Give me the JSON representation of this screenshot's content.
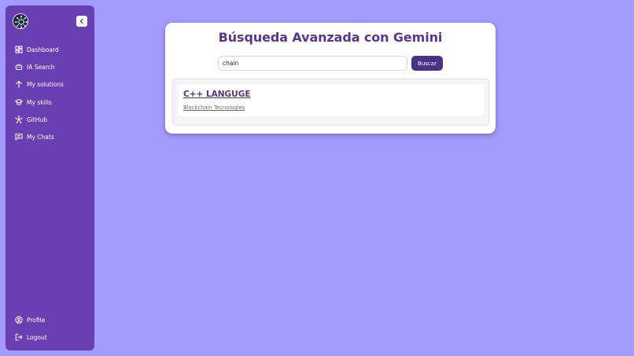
{
  "sidebar": {
    "logo_icon": "brain-network-icon",
    "collapse_icon": "chevron-left-icon",
    "nav": [
      {
        "label": "Dashboard",
        "icon": "dashboard-icon"
      },
      {
        "label": "IA Search",
        "icon": "robot-icon"
      },
      {
        "label": "My solutions",
        "icon": "arrow-up-icon"
      },
      {
        "label": "My skills",
        "icon": "graduation-cap-icon"
      },
      {
        "label": "GitHub",
        "icon": "github-network-icon"
      },
      {
        "label": "My Chats",
        "icon": "chat-icon"
      }
    ],
    "bottom": [
      {
        "label": "Profile",
        "icon": "user-circle-icon"
      },
      {
        "label": "Logout",
        "icon": "logout-icon"
      }
    ]
  },
  "main": {
    "title": "Búsqueda Avanzada con Gemini",
    "search": {
      "value": "chain",
      "button_label": "Buscar"
    },
    "results": [
      {
        "title": "C++ LANGUGE",
        "subtitle": "Blockchain Tecnologies"
      }
    ]
  },
  "colors": {
    "background": "#a29bfb",
    "sidebar": "#6b3fb4",
    "accent": "#4a3384",
    "title": "#5a3591"
  }
}
